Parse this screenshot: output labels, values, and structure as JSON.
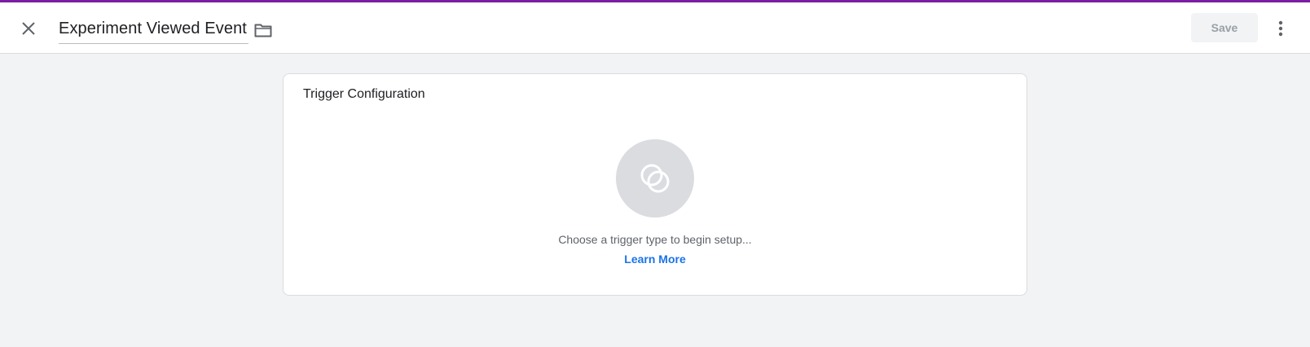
{
  "header": {
    "title": "Experiment Viewed Event",
    "save_label": "Save",
    "accent_color": "#7b1fa2"
  },
  "card": {
    "title": "Trigger Configuration",
    "placeholder": "Choose a trigger type to begin setup...",
    "learn_more": "Learn More"
  },
  "icons": {
    "close": "close-icon",
    "folder": "folder-icon",
    "more": "more-vert-icon",
    "trigger": "trigger-type-icon"
  },
  "colors": {
    "background": "#f1f3f4",
    "link": "#1a73e8"
  }
}
